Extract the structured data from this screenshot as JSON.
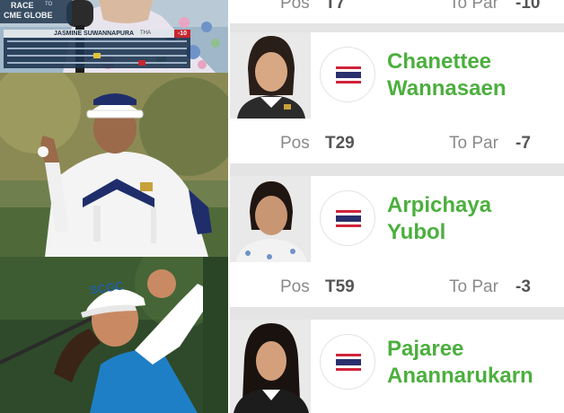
{
  "broadcast": {
    "race_label": "RACE",
    "race_sub": "TO",
    "cme_label": "CME GLOBE",
    "player_name": "JASMINE SUWANNAPURA",
    "country": "THA",
    "score": "-10"
  },
  "photos": {
    "cap_logo": "SCGC"
  },
  "leaderboard": {
    "labels": {
      "pos": "Pos",
      "to_par": "To Par"
    },
    "top_row": {
      "pos": "T7",
      "to_par": "-10"
    },
    "players": [
      {
        "first": "Chanettee",
        "last": "Wannasaen",
        "pos": "T29",
        "to_par": "-7"
      },
      {
        "first": "Arpichaya",
        "last": "Yubol",
        "pos": "T59",
        "to_par": "-3"
      },
      {
        "first": "Pajaree",
        "last": "Anannarukarn"
      }
    ]
  },
  "colors": {
    "name_green": "#4caf3e",
    "separator": "#e4e4e4",
    "flag_red": "#d0243a",
    "flag_blue": "#2a2f6e"
  },
  "icons": [
    "thailand-flag-icon"
  ]
}
